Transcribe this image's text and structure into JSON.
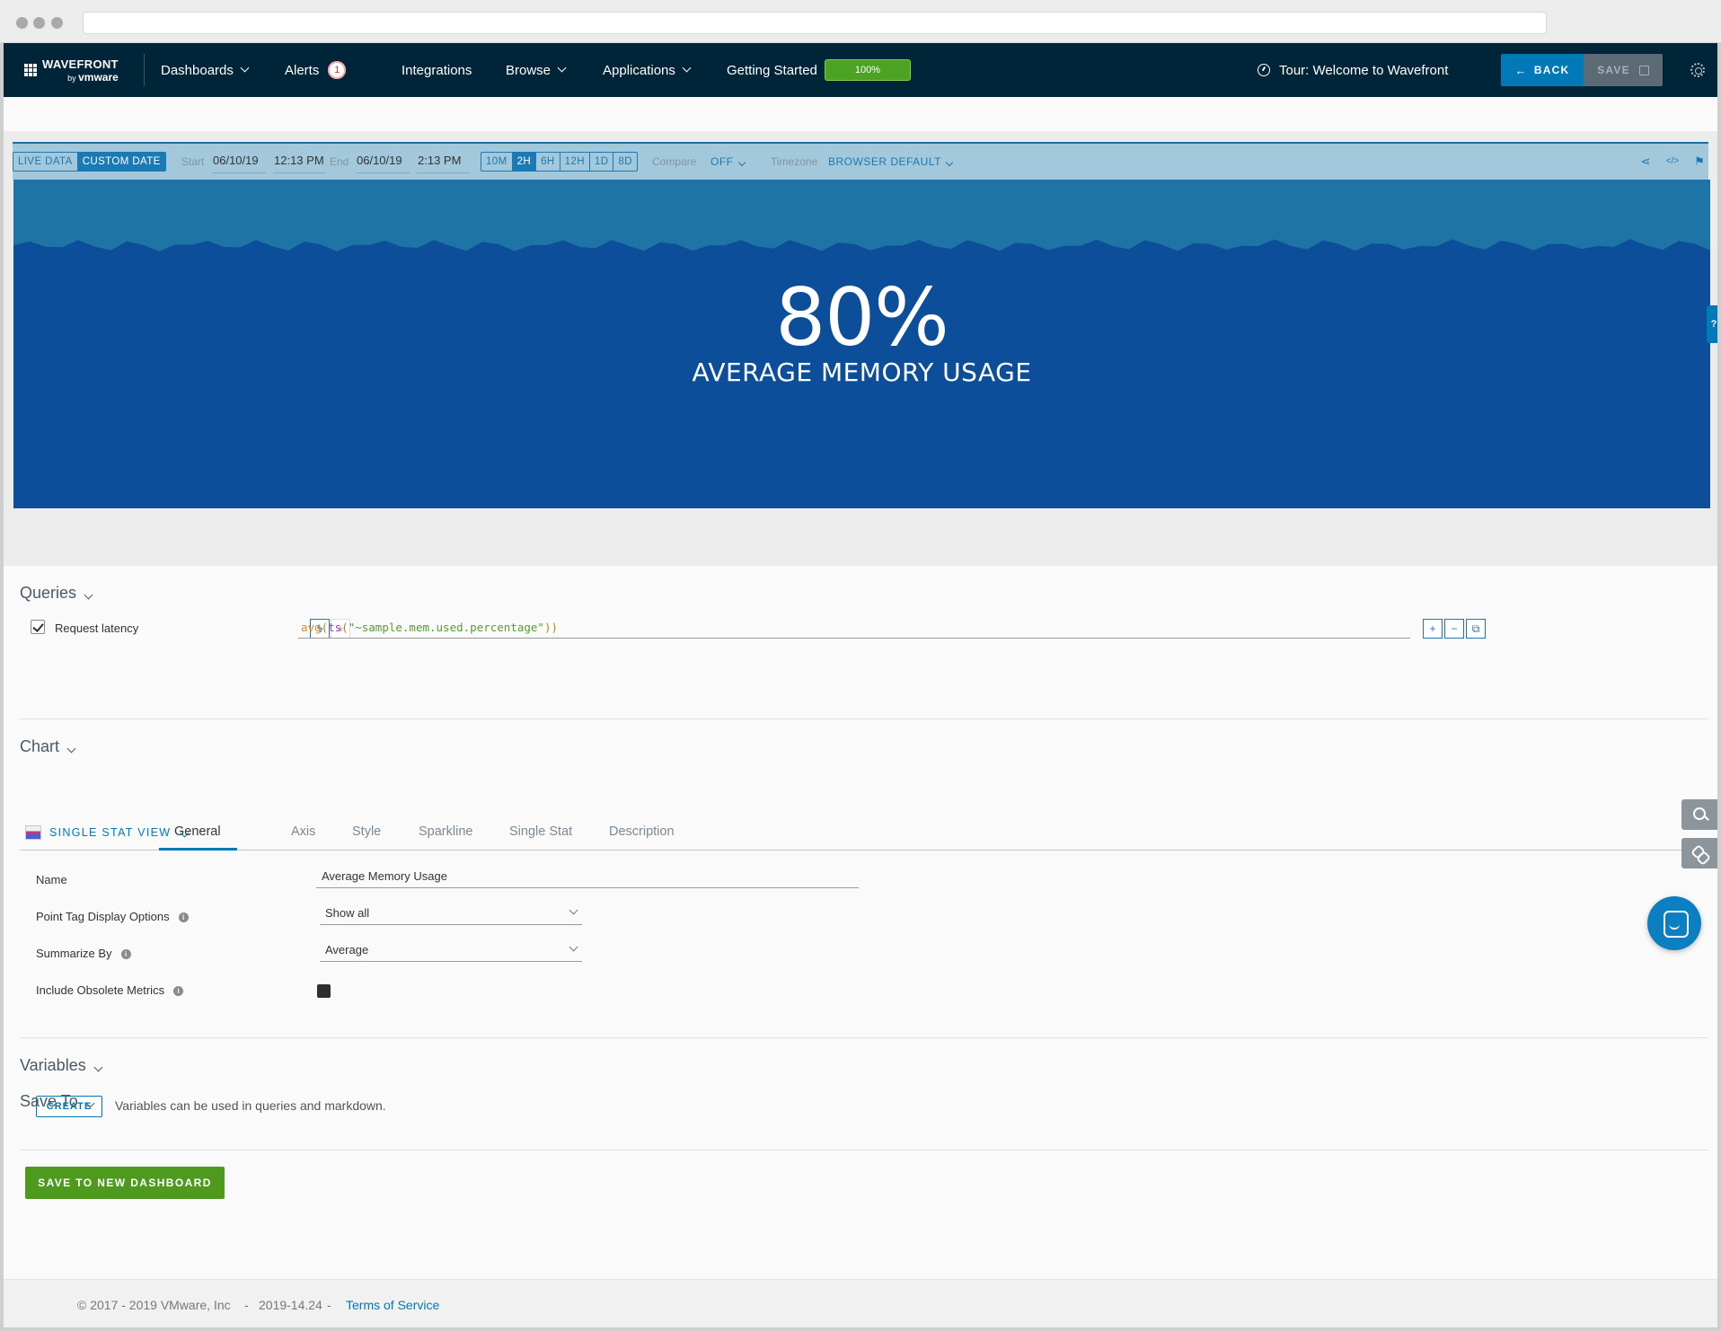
{
  "nav": {
    "logo_text": "WAVEFRONT",
    "logo_by": "by",
    "logo_vmware": "vmware",
    "dashboards": "Dashboards",
    "alerts": "Alerts",
    "alerts_count": "1",
    "integrations": "Integrations",
    "browse": "Browse",
    "applications": "Applications",
    "getting_started": "Getting Started",
    "getting_started_progress": "100%",
    "tour": "Tour: Welcome to Wavefront",
    "back": "BACK",
    "save": "SAVE"
  },
  "timebar": {
    "live_data": "LIVE DATA",
    "custom_date": "CUSTOM DATE",
    "start_label": "Start",
    "start_date": "06/10/19",
    "start_time": "12:13 PM",
    "end_label": "End",
    "end_date": "06/10/19",
    "end_time": "2:13 PM",
    "ranges": [
      "10M",
      "2H",
      "6H",
      "12H",
      "1D",
      "8D"
    ],
    "active_range": "2H",
    "compare_label": "Compare",
    "compare_value": "OFF",
    "timezone_label": "Timezone",
    "timezone_value": "BROWSER DEFAULT"
  },
  "stat": {
    "value": "80%",
    "label": "AVERAGE MEMORY USAGE",
    "fill_fraction": 0.8,
    "help": "?",
    "colors": {
      "background": "#1e74a4",
      "fill": "#0d4e9b"
    }
  },
  "queries": {
    "title": "Queries",
    "row": {
      "name": "Request latency",
      "checked": true,
      "expr_fn": "avg",
      "expr_paren_open": "(",
      "expr_inner_fn": "ts",
      "expr_arg": "\"~sample.mem.used.percentage\"",
      "expr_close": "))"
    },
    "buttons": [
      "+",
      "−",
      "⧉"
    ]
  },
  "chart": {
    "title": "Chart",
    "view": "SINGLE STAT VIEW",
    "tabs": [
      "General",
      "Axis",
      "Style",
      "Sparkline",
      "Single Stat",
      "Description"
    ],
    "active_tab": "General",
    "fields": {
      "name_label": "Name",
      "name_value": "Average Memory Usage",
      "point_tag_label": "Point Tag Display Options",
      "point_tag_value": "Show all",
      "summarize_label": "Summarize By",
      "summarize_value": "Average",
      "obsolete_label": "Include Obsolete Metrics"
    }
  },
  "variables": {
    "title": "Variables",
    "create": "CREATE",
    "help": "Variables can be used in queries and markdown."
  },
  "save_to": {
    "title": "Save To",
    "button": "SAVE TO NEW DASHBOARD"
  },
  "footer": {
    "copyright": "© 2017 - 2019 VMware, Inc",
    "sep": "-",
    "version": "2019-14.24",
    "terms": "Terms of Service"
  }
}
